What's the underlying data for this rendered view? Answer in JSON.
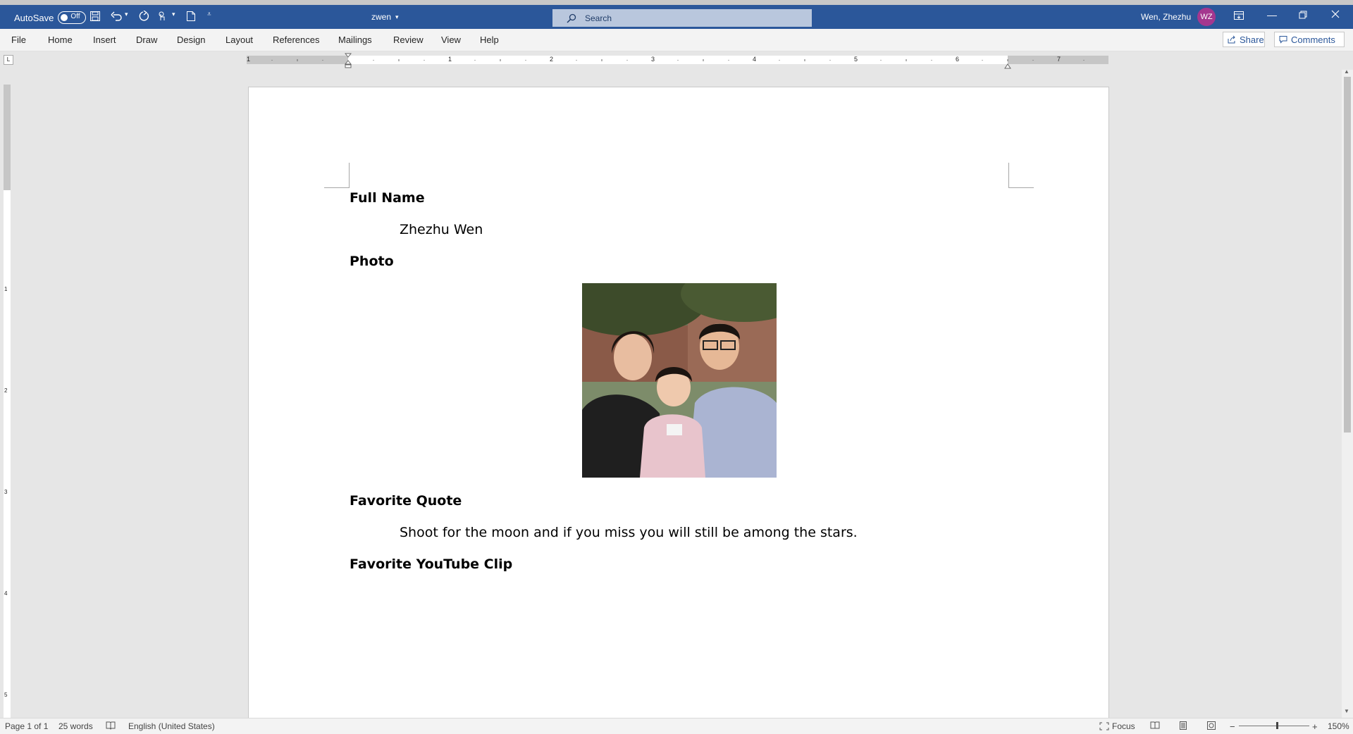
{
  "titlebar": {
    "autosave_label": "AutoSave",
    "autosave_state": "Off",
    "doc_name": "zwen",
    "search_placeholder": "Search",
    "user_name": "Wen, Zhezhu",
    "user_initials": "WZ"
  },
  "menu": {
    "items": [
      "File",
      "Home",
      "Insert",
      "Draw",
      "Design",
      "Layout",
      "References",
      "Mailings",
      "Review",
      "View",
      "Help"
    ],
    "share": "Share",
    "comments": "Comments"
  },
  "ruler": {
    "h_numbers": [
      "1",
      "1",
      "2",
      "3",
      "4",
      "5",
      "6",
      "7"
    ],
    "v_numbers": [
      "1",
      "2",
      "3",
      "4",
      "5"
    ]
  },
  "document": {
    "full_name_heading": "Full Name",
    "full_name_value": "Zhezhu Wen",
    "photo_heading": "Photo",
    "quote_heading": "Favorite Quote",
    "quote_text": "Shoot for the moon and if you miss you will still be among the stars.",
    "clip_heading": "Favorite YouTube Clip"
  },
  "status": {
    "page": "Page 1 of 1",
    "words": "25 words",
    "language": "English (United States)",
    "focus": "Focus",
    "zoom": "150%"
  },
  "colors": {
    "titlebar": "#2b579a",
    "avatar": "#a4378f",
    "comments_accent": "#2b579a"
  }
}
